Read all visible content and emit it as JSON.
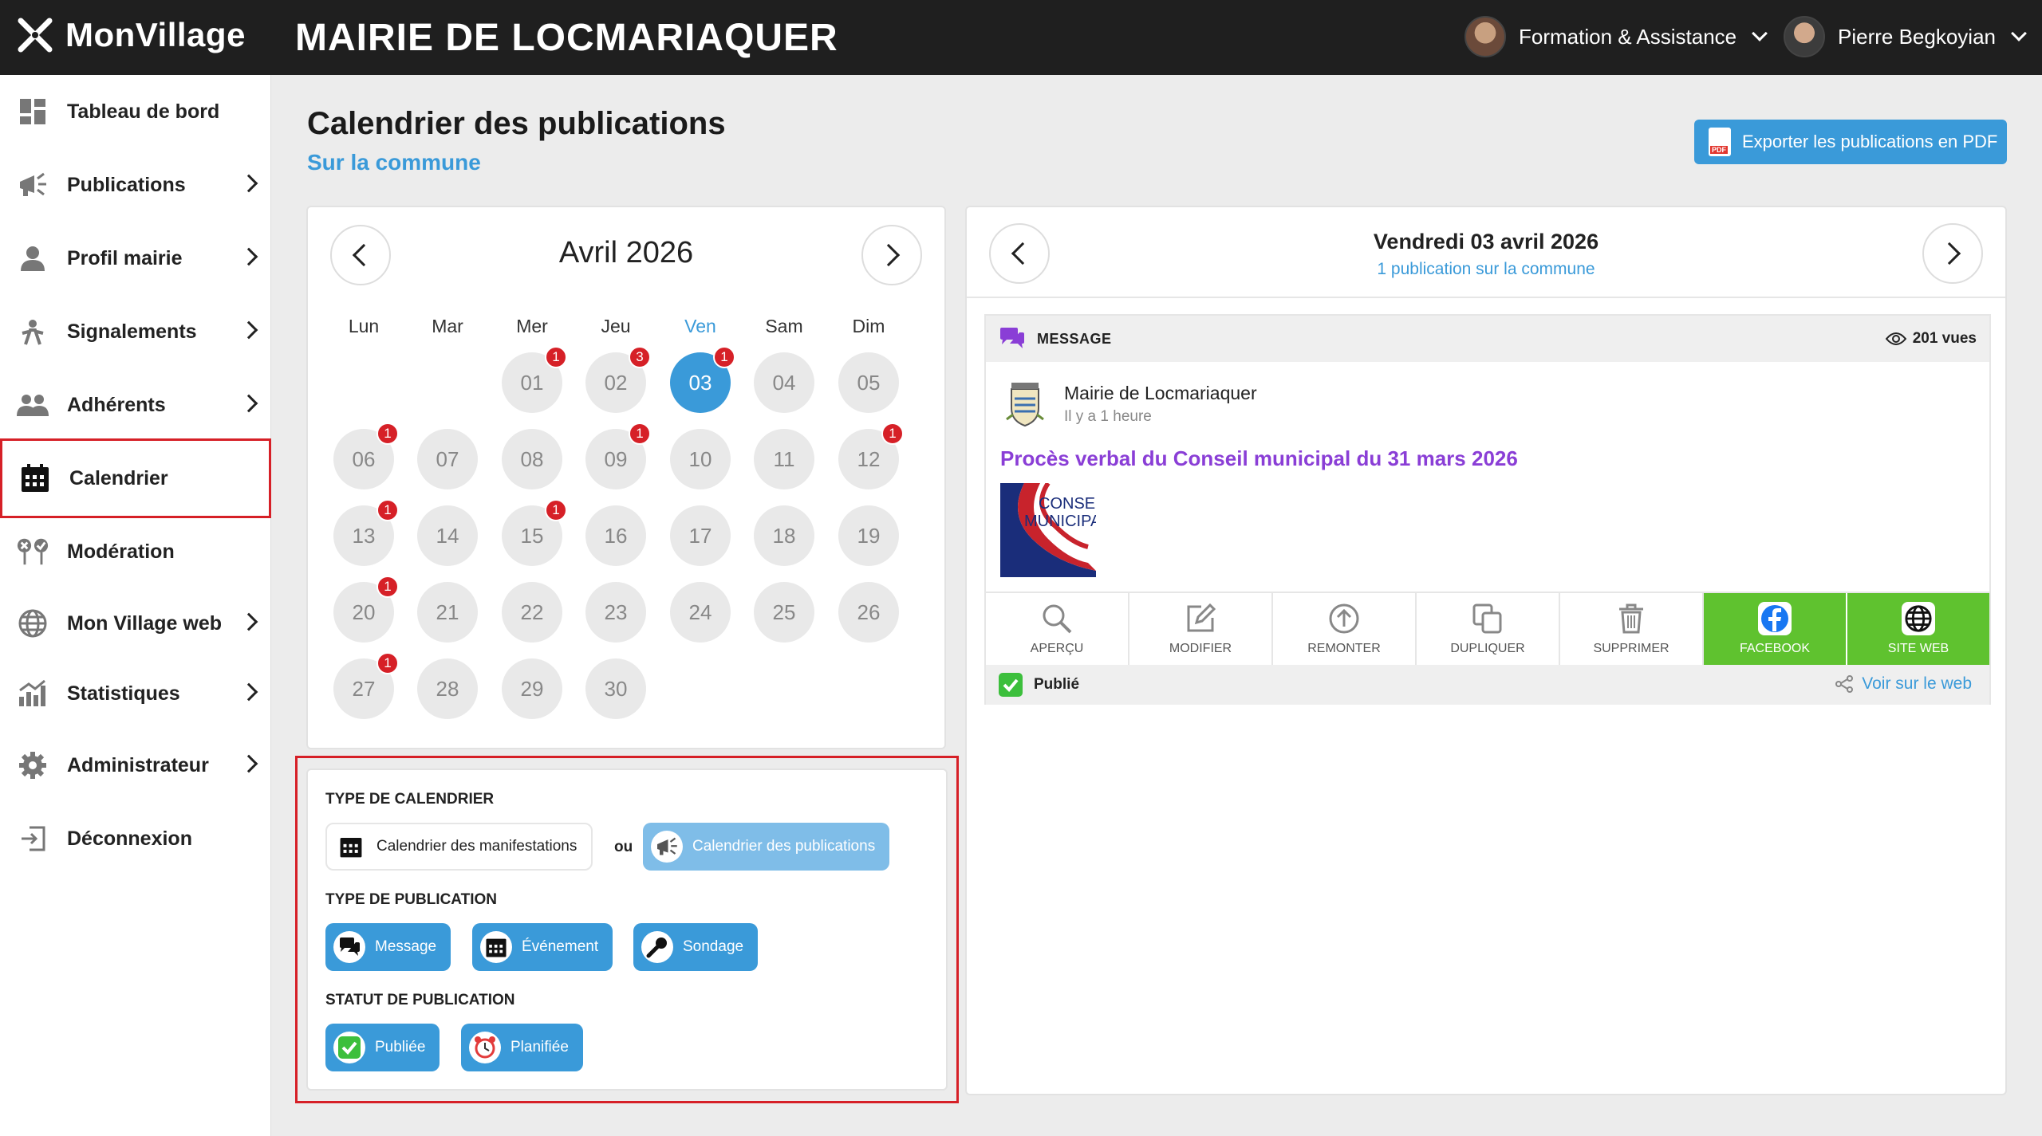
{
  "header": {
    "brand": "MonVillage",
    "mairie": "MAIRIE DE LOCMARIAQUER",
    "help_menu": "Formation & Assistance",
    "user_menu": "Pierre Begkoyian"
  },
  "sidebar": {
    "items": [
      {
        "label": "Tableau de bord",
        "icon": "dashboard-icon"
      },
      {
        "label": "Publications",
        "icon": "megaphone-icon"
      },
      {
        "label": "Profil mairie",
        "icon": "person-icon"
      },
      {
        "label": "Signalements",
        "icon": "alert-icon"
      },
      {
        "label": "Adhérents",
        "icon": "group-icon"
      },
      {
        "label": "Calendrier",
        "icon": "calendar-icon"
      },
      {
        "label": "Modération",
        "icon": "moderation-icon"
      },
      {
        "label": "Mon Village web",
        "icon": "globe-icon"
      },
      {
        "label": "Statistiques",
        "icon": "stats-icon"
      },
      {
        "label": "Administrateur",
        "icon": "gear-icon"
      },
      {
        "label": "Déconnexion",
        "icon": "logout-icon"
      }
    ]
  },
  "page": {
    "title": "Calendrier des publications",
    "subtitle": "Sur la commune",
    "export_label": "Exporter les publications en PDF"
  },
  "calendar": {
    "month": "Avril 2026",
    "weekdays": [
      "Lun",
      "Mar",
      "Mer",
      "Jeu",
      "Ven",
      "Sam",
      "Dim"
    ],
    "days": [
      {
        "d": "01",
        "badge": "1"
      },
      {
        "d": "02",
        "badge": "3"
      },
      {
        "d": "03",
        "badge": "1",
        "selected": true
      },
      {
        "d": "04"
      },
      {
        "d": "05"
      },
      {
        "d": "06",
        "badge": "1"
      },
      {
        "d": "07"
      },
      {
        "d": "08"
      },
      {
        "d": "09",
        "badge": "1"
      },
      {
        "d": "10"
      },
      {
        "d": "11"
      },
      {
        "d": "12",
        "badge": "1"
      },
      {
        "d": "13",
        "badge": "1"
      },
      {
        "d": "14"
      },
      {
        "d": "15",
        "badge": "1"
      },
      {
        "d": "16"
      },
      {
        "d": "17"
      },
      {
        "d": "18"
      },
      {
        "d": "19"
      },
      {
        "d": "20",
        "badge": "1"
      },
      {
        "d": "21"
      },
      {
        "d": "22"
      },
      {
        "d": "23"
      },
      {
        "d": "24"
      },
      {
        "d": "25"
      },
      {
        "d": "26"
      },
      {
        "d": "27",
        "badge": "1"
      },
      {
        "d": "28"
      },
      {
        "d": "29"
      },
      {
        "d": "30"
      }
    ]
  },
  "filters": {
    "calendar_type_heading": "TYPE DE CALENDRIER",
    "manifestations": "Calendrier des manifestations",
    "or": "ou",
    "publications": "Calendrier des publications",
    "pub_type_heading": "TYPE DE PUBLICATION",
    "message": "Message",
    "event": "Événement",
    "poll": "Sondage",
    "status_heading": "STATUT DE PUBLICATION",
    "published": "Publiée",
    "scheduled": "Planifiée"
  },
  "day_panel": {
    "title": "Vendredi 03 avril 2026",
    "subtitle": "1 publication sur la commune",
    "post": {
      "type": "MESSAGE",
      "views": "201 vues",
      "author": "Mairie de Locmariaquer",
      "time": "Il y a 1 heure",
      "title": "Procès verbal du Conseil municipal du 31 mars 2026",
      "thumb_text1": "CONSEI",
      "thumb_text2": "MUNICIPA",
      "actions": [
        "APERÇU",
        "MODIFIER",
        "REMONTER",
        "DUPLIQUER",
        "SUPPRIMER",
        "FACEBOOK",
        "SITE WEB"
      ],
      "status": "Publié",
      "web_link": "Voir sur le web"
    }
  }
}
